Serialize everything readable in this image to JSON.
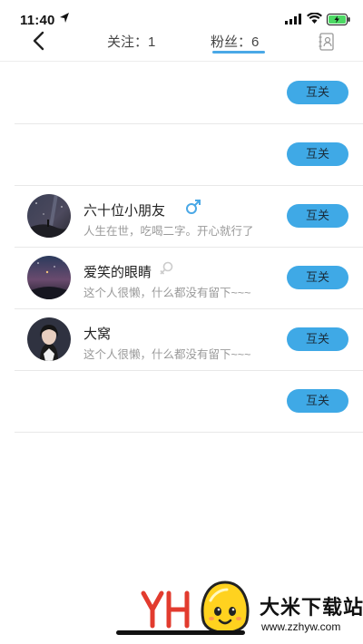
{
  "status_bar": {
    "time": "11:40",
    "icons": [
      "location-arrow-icon",
      "signal-icon",
      "wifi-icon",
      "battery-charging-icon"
    ]
  },
  "nav": {
    "back_icon": "chevron-left-icon",
    "tabs": [
      {
        "label": "关注：1",
        "selected": false
      },
      {
        "label": "粉丝：6",
        "selected": true
      }
    ],
    "right_icon": "contacts-book-icon",
    "accent_color": "#4aa8e6"
  },
  "fans": [
    {
      "name": "",
      "bio": "",
      "gender": "",
      "button": "互关"
    },
    {
      "name": "",
      "bio": "",
      "gender": "",
      "button": "互关"
    },
    {
      "name": "六十位小朋友",
      "bio": "人生在世，吃喝二字。开心就行了",
      "gender": "male-icon",
      "button": "互关"
    },
    {
      "name": "爱笑的眼睛",
      "bio": "这个人很懒，什么都没有留下~~~",
      "gender": "female-icon",
      "button": "互关"
    },
    {
      "name": "大窝",
      "bio": "这个人很懒，什么都没有留下~~~",
      "gender": "",
      "button": "互关"
    },
    {
      "name": "",
      "bio": "",
      "gender": "",
      "button": "互关"
    }
  ],
  "button_color": "#3fa9e6",
  "watermark": {
    "title": "大米下载站",
    "url": "www.zzhyw.com"
  }
}
